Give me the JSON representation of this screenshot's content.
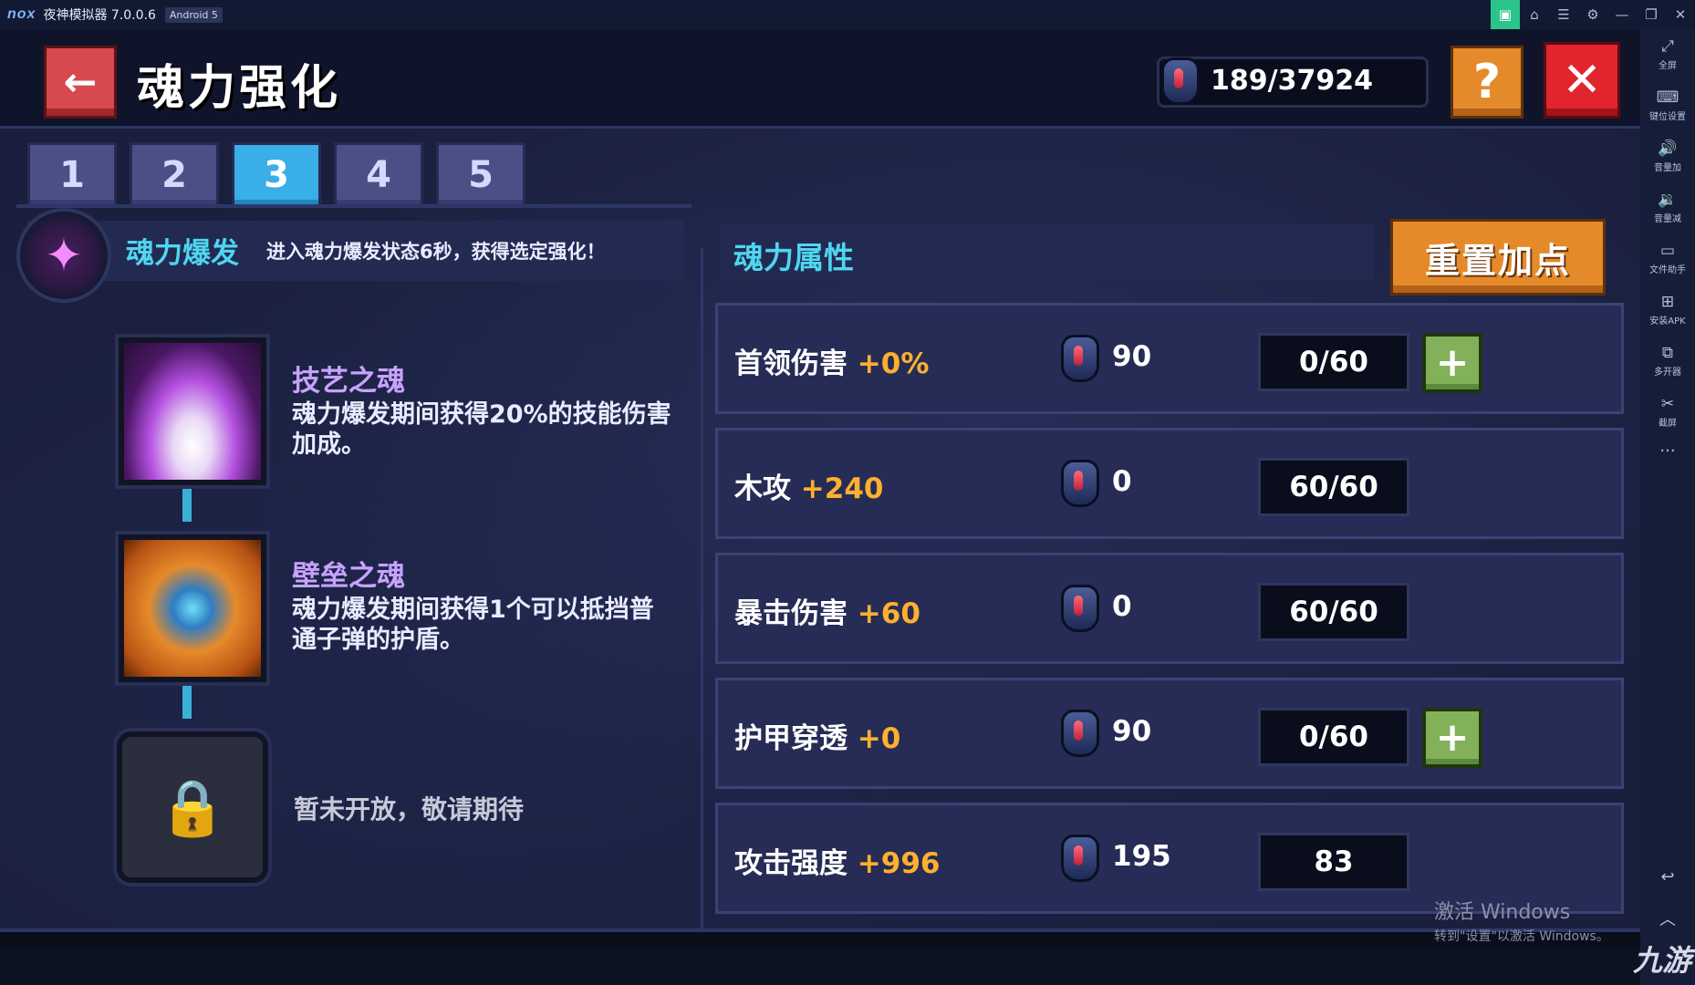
{
  "emulator": {
    "logo": "nox",
    "title": "夜神模拟器 7.0.0.6",
    "android_badge": "Android 5",
    "titlebar_icons": [
      "app-icon",
      "shirt-icon",
      "menu-icon",
      "settings-icon",
      "minimize-icon",
      "restore-icon",
      "close-icon"
    ],
    "sidebar": [
      {
        "icon": "fullscreen-icon",
        "label": "全屏"
      },
      {
        "icon": "keyboard-icon",
        "label": "键位设置"
      },
      {
        "icon": "volume-up-icon",
        "label": "音量加"
      },
      {
        "icon": "volume-down-icon",
        "label": "音量减"
      },
      {
        "icon": "file-helper-icon",
        "label": "文件助手"
      },
      {
        "icon": "install-apk-icon",
        "label": "安装APK"
      },
      {
        "icon": "multi-instance-icon",
        "label": "多开器"
      },
      {
        "icon": "screenshot-icon",
        "label": "截屏"
      }
    ],
    "more": "···"
  },
  "game": {
    "title": "魂力强化",
    "currency": "189/37924",
    "help_label": "?",
    "close_label": "✕",
    "back_label": "←",
    "tabs": [
      "1",
      "2",
      "3",
      "4",
      "5"
    ],
    "active_tab": "3",
    "burst": {
      "title": "魂力爆发",
      "desc": "进入魂力爆发状态6秒，获得选定强化！"
    },
    "skills": [
      {
        "name": "技艺之魂",
        "desc": "魂力爆发期间获得20%的技能伤害加成。"
      },
      {
        "name": "壁垒之魂",
        "desc": "魂力爆发期间获得1个可以抵挡普通子弹的护盾。"
      }
    ],
    "locked_text": "暂未开放，敬请期待",
    "attributes": {
      "title": "魂力属性",
      "reset_label": "重置加点",
      "rows": [
        {
          "name": "首领伤害",
          "bonus": "+0%",
          "cost": "90",
          "level": "0/60",
          "can_add": true
        },
        {
          "name": "木攻",
          "bonus": "+240",
          "cost": "0",
          "level": "60/60",
          "can_add": false
        },
        {
          "name": "暴击伤害",
          "bonus": "+60",
          "cost": "0",
          "level": "60/60",
          "can_add": false
        },
        {
          "name": "护甲穿透",
          "bonus": "+0",
          "cost": "90",
          "level": "0/60",
          "can_add": true
        },
        {
          "name": "攻击强度",
          "bonus": "+996",
          "cost": "195",
          "level": "83",
          "can_add": false
        }
      ],
      "plus_label": "+"
    }
  },
  "watermark": {
    "title": "激活 Windows",
    "subtitle": "转到\"设置\"以激活 Windows。"
  },
  "corner_logo": "九游",
  "colors": {
    "accent_cyan": "#4fd6f0",
    "bonus_orange": "#ffb02e",
    "skill_purple": "#c7a2ff",
    "active_tab": "#3aaee6"
  }
}
